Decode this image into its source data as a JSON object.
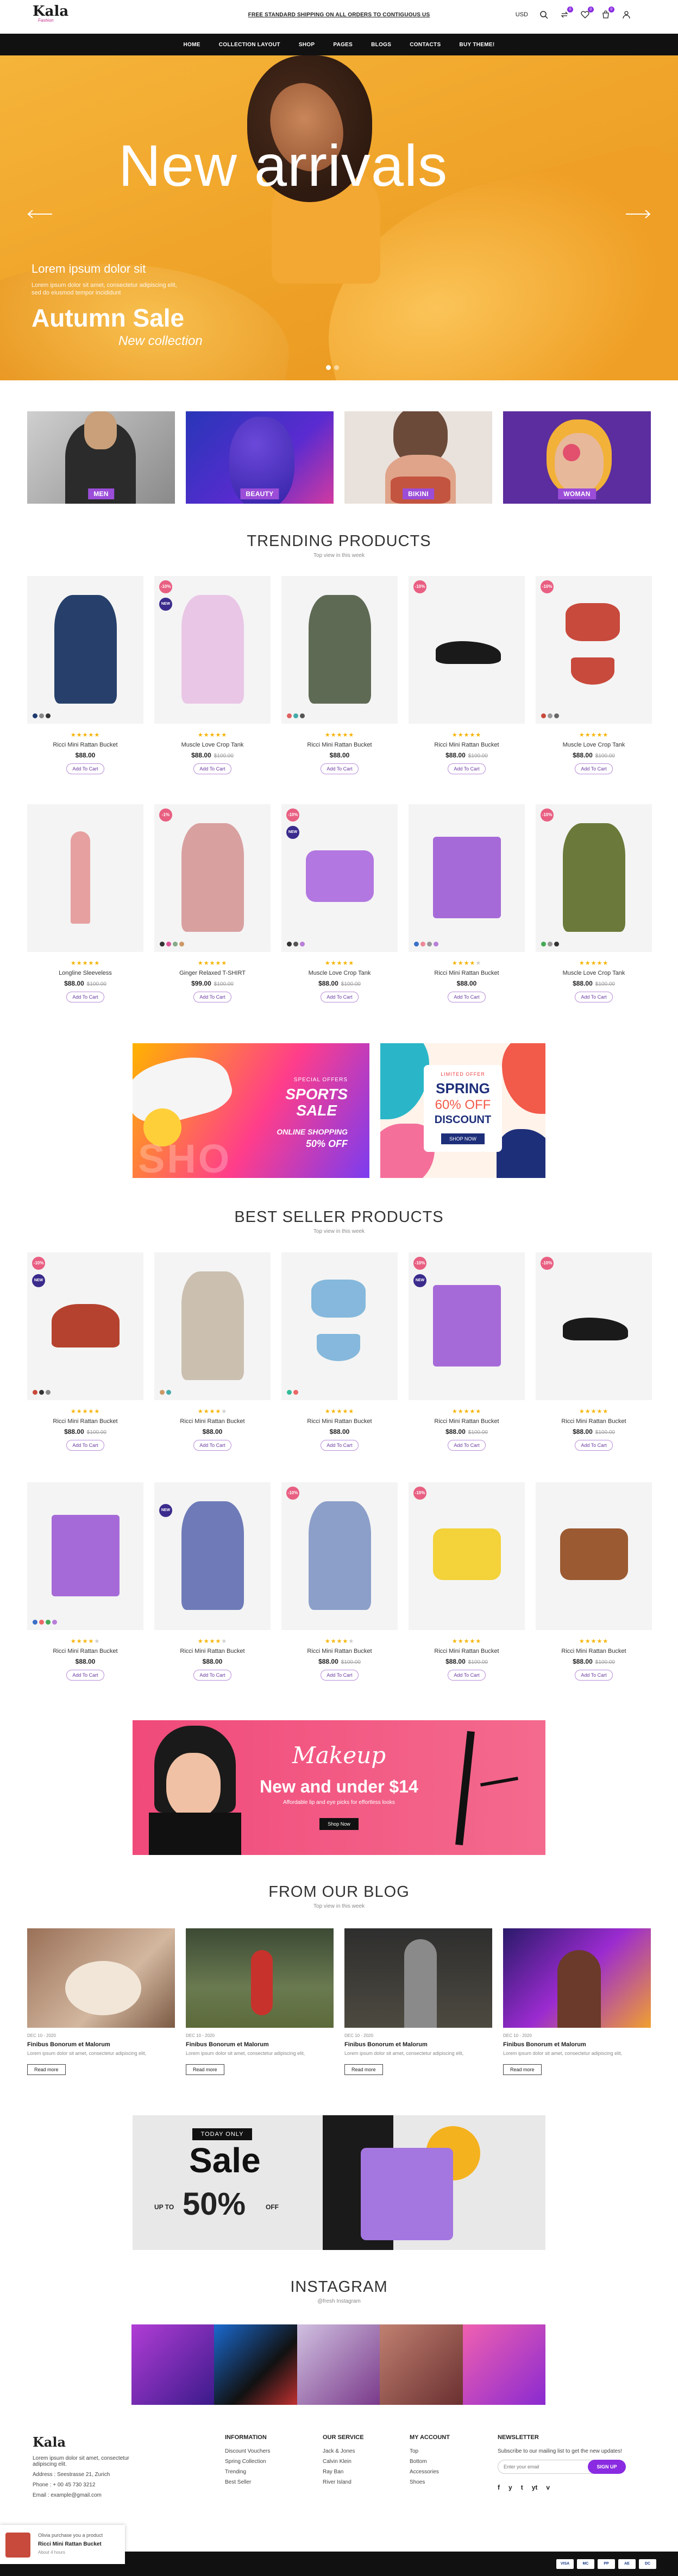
{
  "header": {
    "logo": "Kala",
    "logo_sub": "Fashion",
    "shipping": "FREE STANDARD SHIPPING ON ALL ORDERS TO CONTIGUOUS US",
    "currency": "USD",
    "icons": [
      "search-icon",
      "compare-icon",
      "wishlist-icon",
      "cart-icon",
      "user-icon"
    ],
    "badges": [
      "0",
      "0",
      "0"
    ]
  },
  "nav": [
    "HOME",
    "COLLECTION LAYOUT",
    "SHOP",
    "PAGES",
    "BLOGS",
    "CONTACTS",
    "BUY THEME!"
  ],
  "hero": {
    "title": "New arrivals",
    "small": "Lorem ipsum dolor sit",
    "text": "Lorem ipsum dolor sit amet, consectetur adipiscing elit, sed do eiusmod tempor incididunt",
    "sale": "Autumn Sale",
    "collection": "New collection"
  },
  "categories": [
    "MEN",
    "BEAUTY",
    "BIKINI",
    "WOMAN"
  ],
  "trending": {
    "title": "TRENDING PRODUCTS",
    "sub": "Top view in this week",
    "rows": [
      [
        {
          "name": "Ricci Mini Rattan Bucket",
          "price": "$88.00",
          "old": "",
          "disc": "",
          "new": false,
          "stars": 5,
          "sw": [
            "#1e3a6e",
            "#888",
            "#333"
          ]
        },
        {
          "name": "Muscle Love Crop Tank",
          "price": "$88.00",
          "old": "$100.00",
          "disc": "-10%",
          "new": true,
          "stars": 5,
          "sw": []
        },
        {
          "name": "Ricci Mini Rattan Bucket",
          "price": "$88.00",
          "old": "",
          "disc": "",
          "new": false,
          "stars": 5,
          "sw": [
            "#e06060",
            "#4aa",
            "#555"
          ]
        },
        {
          "name": "Ricci Mini Rattan Bucket",
          "price": "$88.00",
          "old": "$100.00",
          "disc": "-10%",
          "new": false,
          "stars": 5,
          "sw": []
        },
        {
          "name": "Muscle Love Crop Tank",
          "price": "$88.00",
          "old": "$100.00",
          "disc": "-10%",
          "new": false,
          "stars": 5,
          "sw": [
            "#c84a3c",
            "#999",
            "#666"
          ]
        }
      ],
      [
        {
          "name": "Longline Sleeveless",
          "price": "$88.00",
          "old": "$100.00",
          "disc": "",
          "new": false,
          "stars": 5,
          "sw": []
        },
        {
          "name": "Ginger Relaxed T-SHIRT",
          "price": "$99.00",
          "old": "$100.00",
          "disc": "-1%",
          "new": false,
          "stars": 5,
          "sw": [
            "#333",
            "#d59",
            "#8a8",
            "#c96"
          ]
        },
        {
          "name": "Muscle Love Crop Tank",
          "price": "$88.00",
          "old": "$100.00",
          "disc": "-10%",
          "new": true,
          "stars": 5,
          "sw": [
            "#333",
            "#555",
            "#b87fd8"
          ]
        },
        {
          "name": "Ricci Mini Rattan Bucket",
          "price": "$88.00",
          "old": "",
          "disc": "",
          "new": false,
          "stars": 4,
          "sw": [
            "#3b6fc9",
            "#e89",
            "#999",
            "#b87fd8"
          ]
        },
        {
          "name": "Muscle Love Crop Tank",
          "price": "$88.00",
          "old": "$100.00",
          "disc": "-10%",
          "new": false,
          "stars": 5,
          "sw": [
            "#4a5",
            "#999",
            "#333"
          ]
        }
      ]
    ]
  },
  "banners": {
    "sports": {
      "special": "SPECIAL OFFERS",
      "title1": "SPORTS",
      "title2": "SALE",
      "online": "ONLINE SHOPPING",
      "off": "50% OFF",
      "bg_text": "SHO"
    },
    "spring": {
      "limited": "LIMITED OFFER",
      "title": "SPRING",
      "off": "60% OFF",
      "discount": "DISCOUNT",
      "btn": "SHOP NOW"
    }
  },
  "bestseller": {
    "title": "BEST SELLER PRODUCTS",
    "sub": "Top view in this week",
    "rows": [
      [
        {
          "name": "Ricci Mini Rattan Bucket",
          "price": "$88.00",
          "old": "$100.00",
          "disc": "-10%",
          "new": true,
          "stars": 5,
          "sw": [
            "#c84a3c",
            "#333",
            "#888"
          ]
        },
        {
          "name": "Ricci Mini Rattan Bucket",
          "price": "$88.00",
          "old": "",
          "disc": "",
          "new": false,
          "stars": 4,
          "sw": [
            "#c96",
            "#4aa"
          ]
        },
        {
          "name": "Ricci Mini Rattan Bucket",
          "price": "$88.00",
          "old": "",
          "disc": "",
          "new": false,
          "stars": 5,
          "sw": [
            "#3b9",
            "#e66"
          ]
        },
        {
          "name": "Ricci Mini Rattan Bucket",
          "price": "$88.00",
          "old": "$100.00",
          "disc": "-10%",
          "new": true,
          "stars": 5,
          "sw": []
        },
        {
          "name": "Ricci Mini Rattan Bucket",
          "price": "$88.00",
          "old": "$100.00",
          "disc": "-10%",
          "new": false,
          "stars": 5,
          "sw": []
        }
      ],
      [
        {
          "name": "Ricci Mini Rattan Bucket",
          "price": "$88.00",
          "old": "",
          "disc": "",
          "new": false,
          "stars": 4,
          "sw": [
            "#3b6fc9",
            "#e66",
            "#4a5",
            "#b87fd8"
          ]
        },
        {
          "name": "Ricci Mini Rattan Bucket",
          "price": "$88.00",
          "old": "",
          "disc": "",
          "new": true,
          "stars": 4,
          "sw": []
        },
        {
          "name": "Ricci Mini Rattan Bucket",
          "price": "$88.00",
          "old": "$100.00",
          "disc": "-10%",
          "new": false,
          "stars": 4,
          "sw": []
        },
        {
          "name": "Ricci Mini Rattan Bucket",
          "price": "$88.00",
          "old": "$100.00",
          "disc": "-10%",
          "new": false,
          "stars": 5,
          "sw": []
        },
        {
          "name": "Ricci Mini Rattan Bucket",
          "price": "$88.00",
          "old": "$100.00",
          "disc": "",
          "new": false,
          "stars": 5,
          "sw": []
        }
      ]
    ],
    "add_to_cart": "Add To Cart"
  },
  "makeup": {
    "title": "Makeup",
    "line": "New and under $14",
    "sub": "Affordable lip and eye picks for effortless looks",
    "btn": "Shop Now"
  },
  "blog": {
    "title": "FROM OUR BLOG",
    "sub": "Top view in this week",
    "posts": [
      {
        "date": "DEC 10 - 2020",
        "title": "Finibus Bonorum et Malorum",
        "excerpt": "Lorem ipsum dolor sit amet, consectetur adipiscing elit,"
      },
      {
        "date": "DEC 10 - 2020",
        "title": "Finibus Bonorum et Malorum",
        "excerpt": "Lorem ipsum dolor sit amet, consectetur adipiscing elit,"
      },
      {
        "date": "DEC 10 - 2020",
        "title": "Finibus Bonorum et Malorum",
        "excerpt": "Lorem ipsum dolor sit amet, consectetur adipiscing elit,"
      },
      {
        "date": "DEC 10 - 2020",
        "title": "Finibus Bonorum et Malorum",
        "excerpt": "Lorem ipsum dolor sit amet, consectetur adipiscing elit,"
      }
    ],
    "read_more": "Read more"
  },
  "promo": {
    "today": "TODAY ONLY",
    "sale": "Sale",
    "upto": "UP TO",
    "pct": "50%",
    "off": "OFF"
  },
  "instagram": {
    "title": "INSTAGRAM",
    "handle": "@fresh Instagram"
  },
  "footer": {
    "about": "Lorem ipsum dolor sit amet, consectetur adipiscing elit.",
    "address": "Address : Seestrasse 21, Zurich",
    "phone": "Phone : + 00 45 730 3212",
    "email": "Email : example@gmail.com",
    "info": {
      "title": "INFORMATION",
      "items": [
        "Discount Vouchers",
        "Spring Collection",
        "Trending",
        "Best Seller"
      ]
    },
    "service": {
      "title": "OUR SERVICE",
      "items": [
        "Jack & Jones",
        "Calvin Klein",
        "Ray Ban",
        "River Island"
      ]
    },
    "account": {
      "title": "MY ACCOUNT",
      "items": [
        "Top",
        "Bottom",
        "Accessories",
        "Shoes"
      ]
    },
    "newsletter": {
      "title": "NEWSLETTER",
      "text": "Subscribe to our mailing list to get the new updates!",
      "placeholder": "Enter your email",
      "btn": "SIGN UP"
    },
    "social": [
      "f",
      "y",
      "t",
      "yt",
      "v"
    ],
    "payments": [
      "VISA",
      "MC",
      "PP",
      "AE",
      "DC"
    ]
  },
  "toast": {
    "title": "Olivia purchase you a product",
    "name": "Ricci Mini Rattan Bucket",
    "time": "About 4 hours"
  }
}
